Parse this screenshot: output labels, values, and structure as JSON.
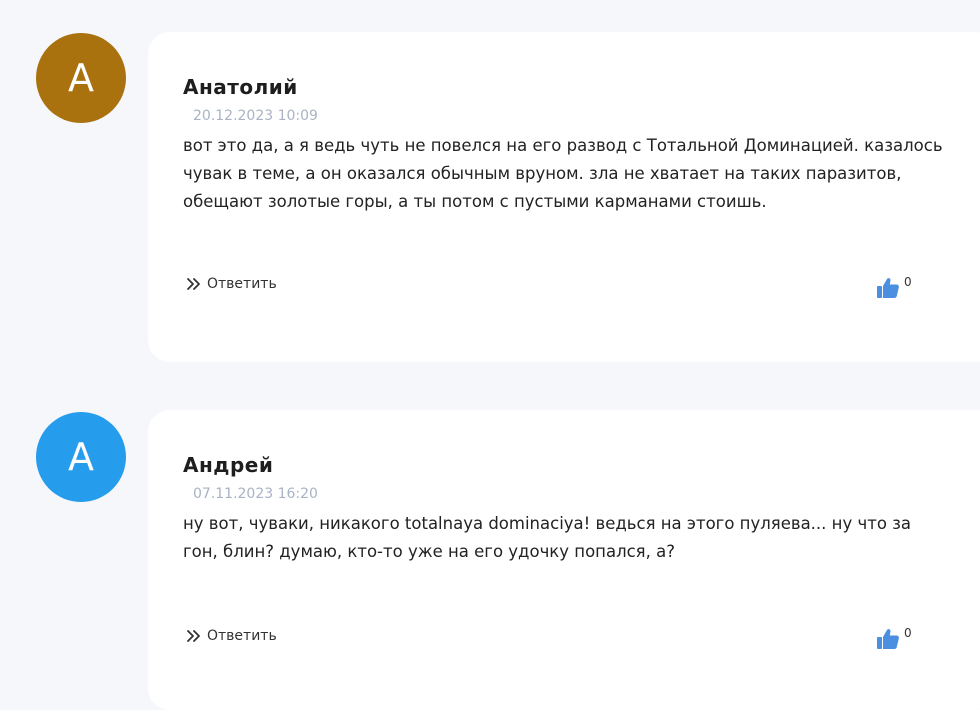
{
  "comments": [
    {
      "avatar_letter": "А",
      "avatar_color": "#a9720f",
      "author": "Анатолий",
      "date": "20.12.2023 10:09",
      "text": "вот это да, а я ведь чуть не повелся на его развод с Тотальной Доминацией. казалось чувак в теме, а он оказался обычным вруном. зла не хватает на таких паразитов, обещают золотые горы, а ты потом с пустыми карманами стоишь.",
      "reply_label": "Ответить",
      "likes": "0"
    },
    {
      "avatar_letter": "А",
      "avatar_color": "#269cec",
      "author": "Андрей",
      "date": "07.11.2023 16:20",
      "text": "ну вот, чуваки, никакого totalnaya dominaciya! ведься на этого пуляева... ну что за гон, блин? думаю, кто-то уже на его удочку попался, а?",
      "reply_label": "Ответить",
      "likes": "0"
    }
  ],
  "colors": {
    "like_icon": "#4a8fe0",
    "card_background": "#ffffff",
    "page_background": "#f6f7fb"
  },
  "icons": {
    "reply": "double-chevron-right-icon",
    "like": "thumbs-up-icon"
  }
}
